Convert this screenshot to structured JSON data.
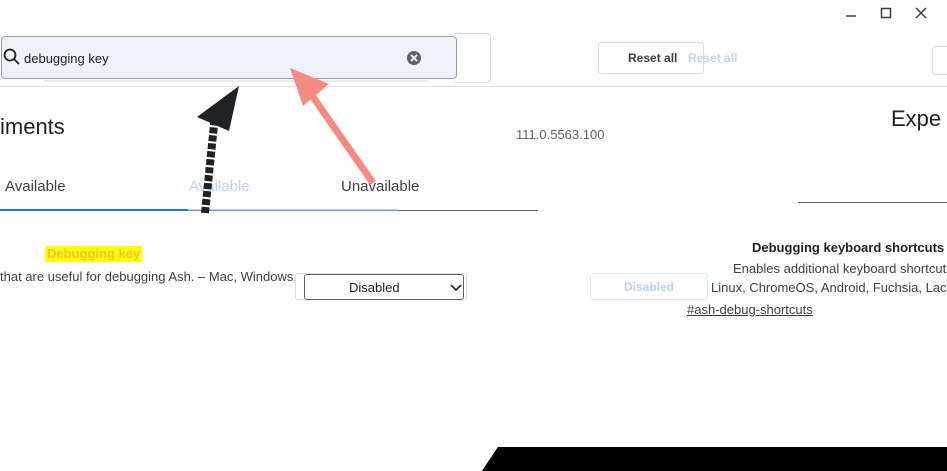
{
  "window": {
    "minimize_icon": "minimize-icon",
    "maximize_icon": "maximize-icon",
    "close_icon": "close-icon"
  },
  "search": {
    "value": "debugging key",
    "icon": "search-icon",
    "clear_icon": "clear-icon"
  },
  "toolbar": {
    "reset_label": "Reset all",
    "reset_ghost": "Reset all"
  },
  "header": {
    "title": "iments",
    "version": "111.0.5563.100",
    "ghost_title": "Expe"
  },
  "tabs": [
    {
      "label": "Available"
    },
    {
      "label": "Available"
    },
    {
      "label": "Unavailable"
    }
  ],
  "experiment": {
    "highlight_name": "Debugging key",
    "description_left": "that are useful for debugging Ash. – Mac, Windows,",
    "select_value": "Disabled",
    "name": "Debugging keyboard shortcuts",
    "description_line1": "Enables additional keyboard shortcuts",
    "description_line2": "Linux, ChromeOS, Android, Fuchsia, Lacro",
    "link": "#ash-debug-shortcuts",
    "ghost_select": "Disabled"
  },
  "colors": {
    "accent": "#1a73e8",
    "highlight": "#ffff00",
    "arrow_red": "#f28b82",
    "arrow_black": "#202124"
  }
}
